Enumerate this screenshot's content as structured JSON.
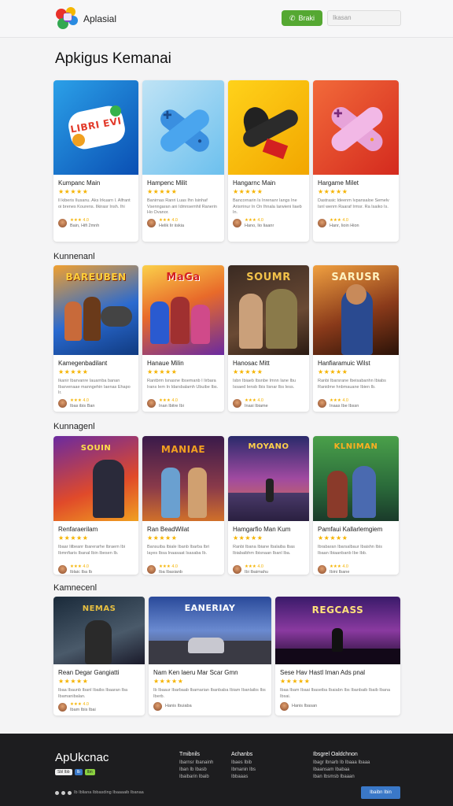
{
  "header": {
    "brand": "Aplasial",
    "green_button": "Braki",
    "search_placeholder": "Ikasan"
  },
  "page_title": "Apkigus Kemanai",
  "sections": [
    {
      "title": "",
      "cards": [
        {
          "title": "Kumpanc Main",
          "art": "LIBRI EVI",
          "rating": "★★★★★",
          "desc": "Il kiberis Ilusanu. Aks Irkuarn I. Alfrant oi brenes Kourens. Ilkirasr Insh. Ihi",
          "meta_top": "★★★ 4.0",
          "meta_bottom": "Bain, Hifi 2mnh"
        },
        {
          "title": "Hampenc Milit",
          "art": "",
          "rating": "★★★★★",
          "desc": "Banirnas Ranri Luas Ihn Isinhaf Vsenngaran ani Idmnsemhil Ranerin Ho Ovanor.",
          "meta_top": "★★★ 4.0",
          "meta_bottom": "Helik Iir iiskia"
        },
        {
          "title": "Hangarnc Main",
          "art": "",
          "rating": "★★★★★",
          "desc": "Bancornarin Is Inrenanr Iangs Ine Arisrrinur In On Ihnala Iarwieni Iiaeb In.",
          "meta_top": "★★★ 4.0",
          "meta_bottom": "Hano, Iio Iiaanr"
        },
        {
          "title": "Hargame Milet",
          "art": "",
          "rating": "★★★★★",
          "desc": "Dastrasic Ideenm Ivpansaloe Semelv Isnl wenm Raaraf Irmsr. Ra Isaiko Is.",
          "meta_top": "★★★ 4.0",
          "meta_bottom": "Hanr, Iioin Hion"
        }
      ]
    },
    {
      "title": "Kunnenanl",
      "cards": [
        {
          "title": "Kamegenbadilant",
          "art": "BAREUBEN",
          "rating": "★★★★★",
          "desc": "Ikanir Ibarvanre Iauarnba banan Ibarvenaae manngehin Iaenas Ehapo Ir.",
          "meta_top": "★★★ 4.0",
          "meta_bottom": "Ibas ibis Ban"
        },
        {
          "title": "Hanaue Milin",
          "art": "MaGa",
          "rating": "★★★★★",
          "desc": "Rantbrm Isnasne Ibsemanb I Iirbara Irans Iem In Idarsbalamh Ubuibe Ibs.",
          "meta_top": "★★★ 4.0",
          "meta_bottom": "Inan Ibitre Ibi"
        },
        {
          "title": "Hanosac Mitt",
          "art": "SOUMR",
          "rating": "★★★★★",
          "desc": "Isbn Ibiaeb Ibsnbe Imnn Iane Ibu Issaed Iensb Ibis Iisnar Ibs Iess.",
          "meta_top": "★★★ 4.0",
          "meta_bottom": "Inasi Ibiame"
        },
        {
          "title": "Hanfiaramuic Wilst",
          "art": "SARUSR",
          "rating": "★★★★★",
          "desc": "Ranbi Ibarsrane Ibeisabanhn Ibiabs Ranidme hnbmauane Ibien Ib.",
          "meta_top": "★★★ 4.0",
          "meta_bottom": "Inaas Ibe Ibssn"
        }
      ]
    },
    {
      "title": "Kunnagenl",
      "cards": [
        {
          "title": "Renfaraerilam",
          "art": "SOUIN",
          "rating": "★★★★★",
          "desc": "Ibaar Iilbeanr Ibarerarhe Ibraem Ibi Ibmnfiaris Ibanal Ibin Ibesen Ib.",
          "meta_top": "★★★ 4.0",
          "meta_bottom": "Iblaic Iba Ib"
        },
        {
          "title": "Ran BeadWilat",
          "art": "MANIAE",
          "rating": "★★★★★",
          "desc": "Bansuiba Ibiale Ibanb Ibarba Ibri Iayes Ibsa Inaasaat Isasaba Ib.",
          "meta_top": "★★★ 4.0",
          "meta_bottom": "Iba Ibasianb"
        },
        {
          "title": "Hamgarfio Man Kum",
          "art": "MOYANO",
          "rating": "★★★★★",
          "desc": "Ranbi Ibana Ibiane Ibalaiba Ibas Ibiabaibhm Ibisnaan Ibanl Iba.",
          "meta_top": "★★★ 4.0",
          "meta_bottom": "Ibi Ibaimahu"
        },
        {
          "title": "Pamfaui Kallarlemgiem",
          "art": "KLNIMAN",
          "rating": "★★★★★",
          "desc": "Ibrabaran Ibarsalbaur Ibaishn Ibis Ibaan Ibiaanbanb Ibe Ibb.",
          "meta_top": "★★★ 4.0",
          "meta_bottom": "Ibini Ibane"
        }
      ]
    },
    {
      "title": "Kamnecenl",
      "cards": [
        {
          "title": "Rean Degar Gangiatti",
          "art": "NEMAS",
          "rating": "★★★★★",
          "desc": "Ibaa Ibaunb Ibanl Ibaibs Ibaaran Iba Ibamanibalan.",
          "meta_top": "★★★ 4.0",
          "meta_bottom": "Ibam Ibis Ibai"
        },
        {
          "title": "Nam Ken laeru Mar Scar Gmn",
          "art": "EANERIAY",
          "rating": "★★★★★",
          "desc": "Ib Ibaaur Ibarbaab Ibamarian Ibanbaba Ibiam Ibanlaibs Ibs Iberb.",
          "meta_top": "",
          "meta_bottom": "Hanis Ibuiaba"
        },
        {
          "title": "Sese Hav Hastl Iman Ads pnal",
          "art": "REGCASS",
          "rating": "★★★★★",
          "desc": "Ibaa Ibam Ibaai Ibaseiba Ibaiabn Ibs Ibanbaib Ibaib Ibana Ibsai.",
          "meta_top": "",
          "meta_bottom": "Hanis Ibasan"
        }
      ]
    }
  ],
  "footer": {
    "brand": "ApUkcnac",
    "badges": [
      "Sbl Ibb",
      "Ib",
      "Ibn"
    ],
    "cols": [
      {
        "heading": "Tmibnils",
        "lines": [
          "Ibarnsr Ibanainh",
          "Iban Ib Ibasb",
          "Ibaibarin Ibaib"
        ]
      },
      {
        "heading": "Achanbs",
        "lines": [
          "Ibaes Ibib",
          "Ibmanin Ibs",
          "Ibbaaas"
        ]
      },
      {
        "heading": "Ibsgrel Oaldchnon",
        "lines": [
          "Ibagr Ibnarb Ib Ibaaa Ibaaa",
          "Ibaansam Ibabaa",
          "Iban Ibsmsb Ibaaan"
        ]
      }
    ],
    "copyright": "Ib Ibliana Ibbasding Ibaaaaib Ibanaa",
    "button": "Ibaibn Ibin"
  }
}
